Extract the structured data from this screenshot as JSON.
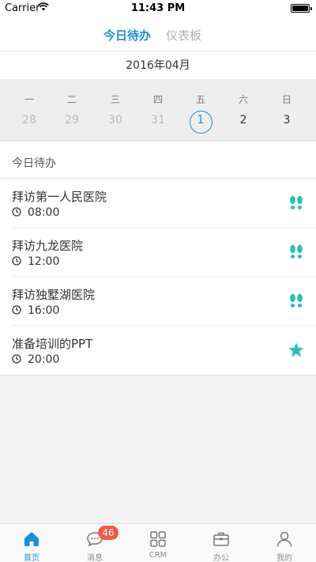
{
  "status_bar": {
    "carrier": "Carrier",
    "time": "11:43 PM"
  },
  "header": {
    "tabs": [
      {
        "label": "今日待办",
        "active": true
      },
      {
        "label": "仪表板",
        "active": false
      }
    ]
  },
  "calendar": {
    "month_label": "2016年04月",
    "weekdays": [
      "一",
      "二",
      "三",
      "四",
      "五",
      "六",
      "日"
    ],
    "dates": [
      {
        "day": "28",
        "state": "prev"
      },
      {
        "day": "29",
        "state": "prev"
      },
      {
        "day": "30",
        "state": "prev"
      },
      {
        "day": "31",
        "state": "prev"
      },
      {
        "day": "1",
        "state": "today"
      },
      {
        "day": "2",
        "state": "current"
      },
      {
        "day": "3",
        "state": "current"
      }
    ]
  },
  "todo": {
    "section_title": "今日待办",
    "items": [
      {
        "title": "拜访第一人民医院",
        "time": "08:00",
        "icon": "footprints-icon"
      },
      {
        "title": "拜访九龙医院",
        "time": "12:00",
        "icon": "footprints-icon"
      },
      {
        "title": "拜访独墅湖医院",
        "time": "16:00",
        "icon": "footprints-icon"
      },
      {
        "title": "准备培训的PPT",
        "time": "20:00",
        "icon": "star-icon"
      }
    ]
  },
  "tab_bar": {
    "items": [
      {
        "label": "首页",
        "icon": "home-icon",
        "active": true
      },
      {
        "label": "消息",
        "icon": "chat-icon",
        "badge": "46"
      },
      {
        "label": "CRM",
        "icon": "grid-icon"
      },
      {
        "label": "办公",
        "icon": "briefcase-icon"
      },
      {
        "label": "我的",
        "icon": "person-icon"
      }
    ]
  },
  "colors": {
    "accent": "#1e8fd8",
    "teal": "#2fbfb4",
    "badge": "#f05a4a"
  }
}
